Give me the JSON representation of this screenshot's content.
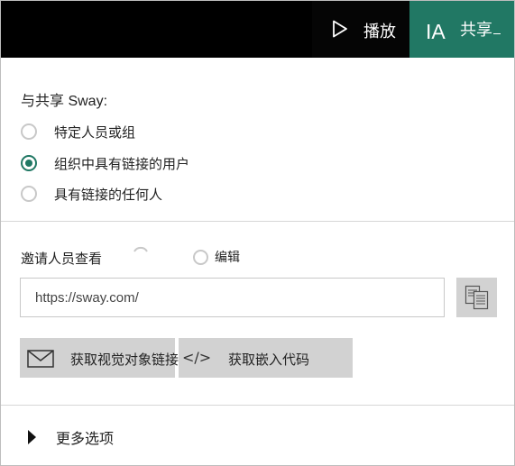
{
  "topbar": {
    "play_label": "播放",
    "user_initials": "IA",
    "share_label": "共享",
    "play_icon": "play-icon",
    "colors": {
      "bar": "#000000",
      "share": "#217864"
    }
  },
  "share_with": {
    "title": "与共享 Sway:",
    "options": [
      {
        "label": "特定人员或组",
        "checked": false
      },
      {
        "label": "组织中具有链接的用户",
        "checked": true
      },
      {
        "label": "具有链接的任何人",
        "checked": false
      }
    ]
  },
  "permissions": {
    "view_label": "邀请人员查看",
    "edit_label": "编辑"
  },
  "link": {
    "url": "https://sway.com/",
    "copy_icon": "copy-icon"
  },
  "actions": {
    "visual_link_label": "获取视觉对象链接",
    "embed_code_label": "获取嵌入代码",
    "embed_glyph": "</>"
  },
  "more_options": {
    "label": "更多选项"
  }
}
